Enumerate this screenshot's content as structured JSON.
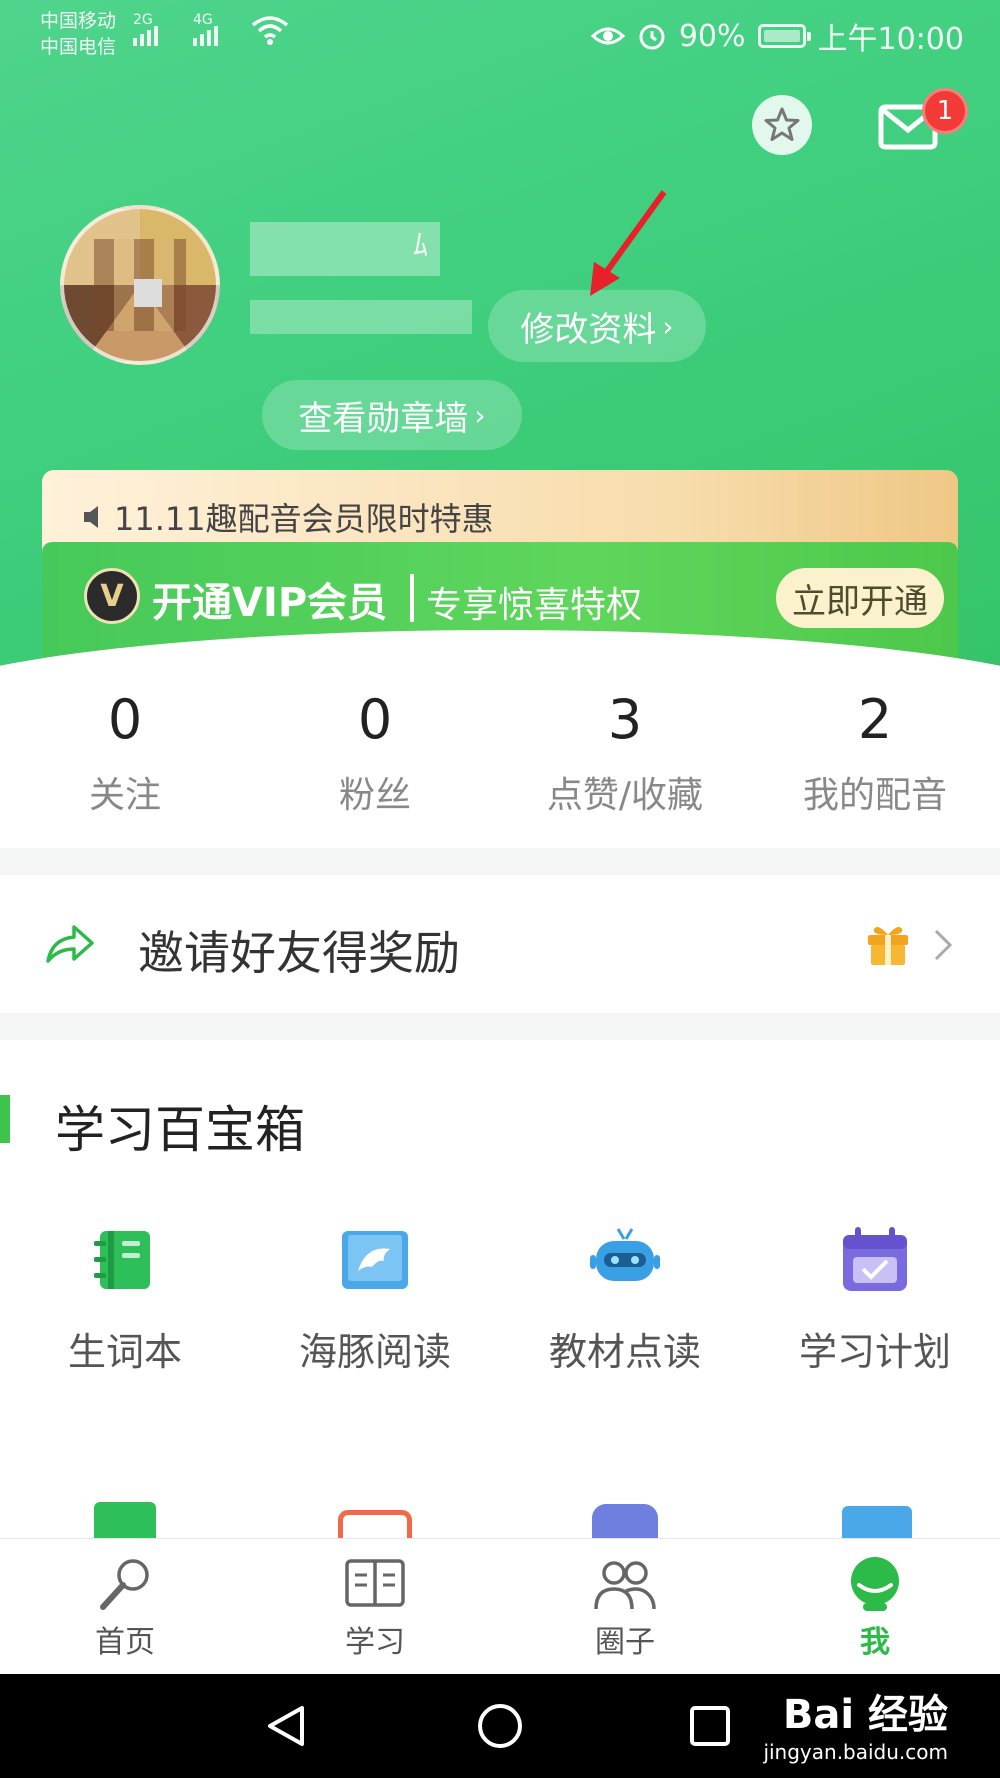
{
  "status_bar": {
    "carrier_1": "中国移动",
    "carrier_2": "中国电信",
    "net_1": "2G",
    "net_2": "4G",
    "battery": "90%",
    "time": "上午10:00"
  },
  "header": {
    "notification_count": "1",
    "edit_profile_label": "修改资料",
    "badge_wall_label": "查看勋章墙",
    "chevron": "›"
  },
  "promo": {
    "text": "11.11趣配音会员限时特惠",
    "vip_logo": "V",
    "vip_title": "开通VIP会员",
    "vip_subtitle": "专享惊喜特权",
    "vip_button": "立即开通"
  },
  "stats": [
    {
      "value": "0",
      "label": "关注"
    },
    {
      "value": "0",
      "label": "粉丝"
    },
    {
      "value": "3",
      "label": "点赞/收藏"
    },
    {
      "value": "2",
      "label": "我的配音"
    }
  ],
  "invite": {
    "label": "邀请好友得奖励",
    "icons": [
      "share-arrow-icon",
      "gift-icon",
      "chevron-right-icon"
    ]
  },
  "toolbox": {
    "title": "学习百宝箱",
    "items": [
      {
        "label": "生词本",
        "icon": "notebook-icon",
        "color": "#2fbf5a"
      },
      {
        "label": "海豚阅读",
        "icon": "dolphin-book-icon",
        "color": "#4aa8e8"
      },
      {
        "label": "教材点读",
        "icon": "robot-icon",
        "color": "#3aa0e6"
      },
      {
        "label": "学习计划",
        "icon": "calendar-icon",
        "color": "#7a6ae0"
      }
    ]
  },
  "tabbar": [
    {
      "label": "首页",
      "icon": "microphone-icon"
    },
    {
      "label": "学习",
      "icon": "book-icon"
    },
    {
      "label": "圈子",
      "icon": "group-icon"
    },
    {
      "label": "我",
      "icon": "profile-icon",
      "active": true
    }
  ],
  "watermark": {
    "brand": "Bai 经验",
    "url": "jingyan.baidu.com"
  },
  "colors": {
    "accent": "#2cba48",
    "badge": "#f23a36",
    "header": "#3fcf7e"
  }
}
